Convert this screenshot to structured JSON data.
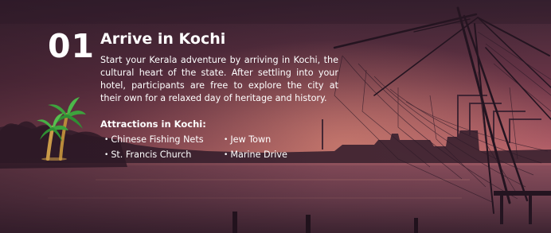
{
  "day": {
    "number": "01",
    "title": "Arrive in Kochi",
    "description": "Start your Kerala adventure by arriving in Kochi, the cultural heart of the state. After settling into your hotel, participants are free to explore the city at their own for a relaxed day of heritage and history."
  },
  "attractions": {
    "heading": "Attractions in Kochi:",
    "items": [
      "Chinese Fishing Nets",
      "Jew Town",
      "St. Francis Church",
      "Marine Drive"
    ]
  },
  "icons": {
    "decoration": "palm-trees-icon"
  },
  "colors": {
    "sky_top": "#3b2636",
    "sky_mid": "#8c4a5a",
    "sky_glow": "#d07a6e",
    "water": "#4a2a36",
    "text": "#ffffff"
  }
}
